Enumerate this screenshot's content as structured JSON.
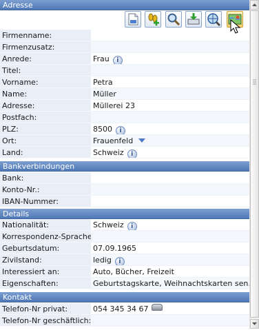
{
  "sections": {
    "adresse": "Adresse",
    "bank": "Bankverbindungen",
    "details": "Details",
    "kontakt": "Kontakt"
  },
  "toolbar": {
    "buttons": [
      {
        "icon": "new-document-icon"
      },
      {
        "icon": "add-footprints-icon"
      },
      {
        "icon": "search-icon"
      },
      {
        "icon": "print-download-icon"
      },
      {
        "icon": "web-search-icon"
      },
      {
        "icon": "map-icon"
      }
    ]
  },
  "adresse": {
    "firmenname": {
      "label": "Firmenname:",
      "value": ""
    },
    "firmenzusatz": {
      "label": "Firmenzusatz:",
      "value": ""
    },
    "anrede": {
      "label": "Anrede:",
      "value": "Frau"
    },
    "titel": {
      "label": "Titel:",
      "value": ""
    },
    "vorname": {
      "label": "Vorname:",
      "value": "Petra"
    },
    "name": {
      "label": "Name:",
      "value": "Müller"
    },
    "adresse": {
      "label": "Adresse:",
      "value": "Müllerei 23"
    },
    "postfach": {
      "label": "Postfach:",
      "value": ""
    },
    "plz": {
      "label": "PLZ:",
      "value": "8500"
    },
    "ort": {
      "label": "Ort:",
      "value": "Frauenfeld"
    },
    "land": {
      "label": "Land:",
      "value": "Schweiz"
    }
  },
  "bank": {
    "bank": {
      "label": "Bank:",
      "value": ""
    },
    "konto": {
      "label": "Konto-Nr.:",
      "value": ""
    },
    "iban": {
      "label": "IBAN-Nummer:",
      "value": ""
    }
  },
  "details": {
    "nationalitaet": {
      "label": "Nationalität:",
      "value": "Schweiz"
    },
    "sprache": {
      "label": "Korrespondenz-Sprache:",
      "value": ""
    },
    "geburtsdatum": {
      "label": "Geburtsdatum:",
      "value": "07.09.1965"
    },
    "zivilstand": {
      "label": "Zivilstand:",
      "value": "ledig"
    },
    "interessen": {
      "label": "Interessiert an:",
      "value": "Auto, Bücher, Freizeit"
    },
    "eigenschaften": {
      "label": "Eigenschaften:",
      "value": "Geburtstagskarte, Weihnachtskarten sen..."
    }
  },
  "kontakt": {
    "privat": {
      "label": "Telefon-Nr privat:",
      "value": "054 345 34 67"
    },
    "geschaeftlich": {
      "label": "Telefon-Nr geschäftlich:",
      "value": ""
    }
  }
}
